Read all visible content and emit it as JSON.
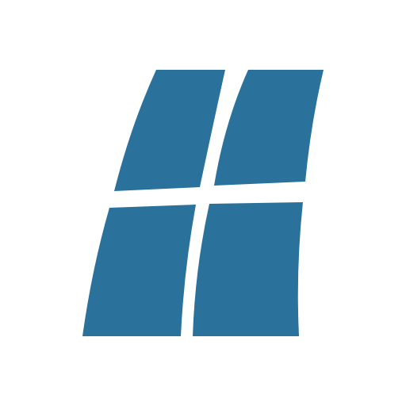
{
  "logo": {
    "icon": "four-pane-window-logo-icon",
    "color": "#2a729b",
    "background": "#ffffff"
  }
}
